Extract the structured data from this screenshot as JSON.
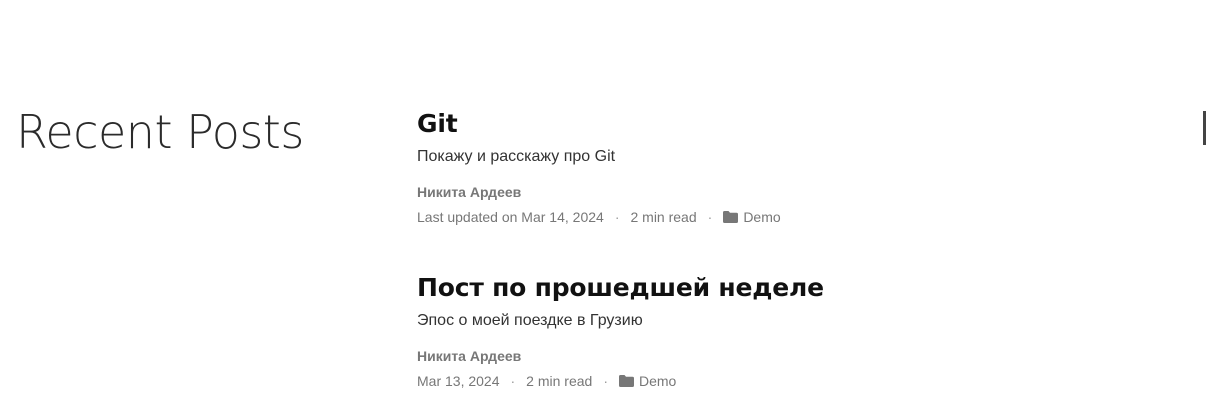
{
  "section": {
    "title": "Recent Posts"
  },
  "posts": [
    {
      "title": "Git",
      "summary": "Покажу и расскажу про Git",
      "author": "Никита Ардеев",
      "date_text": "Last updated on Mar 14, 2024",
      "read_time": "2 min read",
      "category": "Demo"
    },
    {
      "title": "Пост по прошедшей неделе",
      "summary": "Эпос о моей поездке в Грузию",
      "author": "Никита Ардеев",
      "date_text": "Mar 13, 2024",
      "read_time": "2 min read",
      "category": "Demo"
    }
  ],
  "meta_separator": "·",
  "icons": {
    "category": "folder-icon"
  }
}
